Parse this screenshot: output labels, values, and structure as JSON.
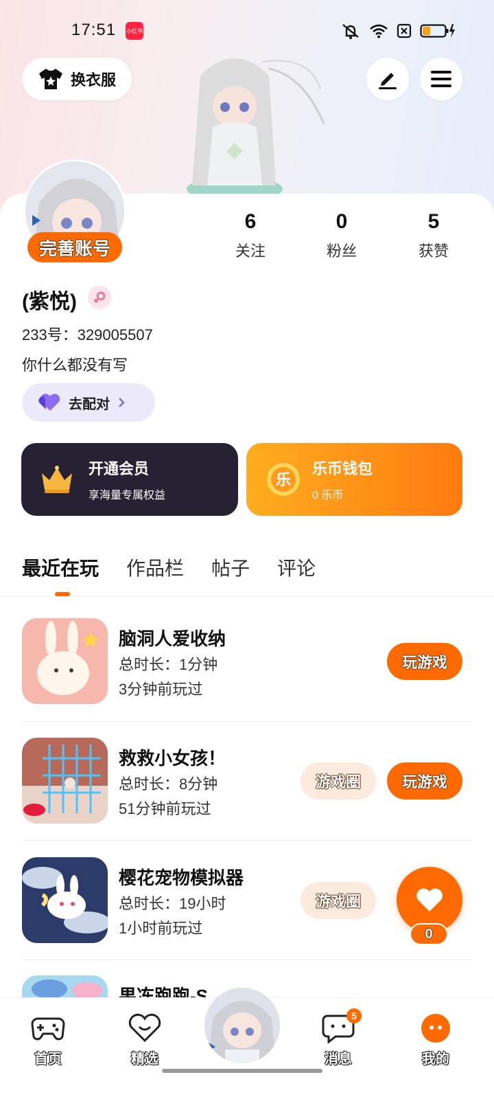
{
  "status_bar": {
    "time": "17:51",
    "app_badge": "小红书"
  },
  "header": {
    "wardrobe_label": "换衣服"
  },
  "profile": {
    "complete_account_label": "完善账号",
    "stats": [
      {
        "num": "6",
        "label": "关注"
      },
      {
        "num": "0",
        "label": "粉丝"
      },
      {
        "num": "5",
        "label": "获赞"
      }
    ],
    "name": "(紫悦)",
    "id_text": "233号：329005507",
    "bio": "你什么都没有写",
    "match_label": "去配对"
  },
  "cards": {
    "vip": {
      "title": "开通会员",
      "subtitle": "享海量专属权益"
    },
    "coin": {
      "icon_char": "乐",
      "title": "乐币钱包",
      "subtitle": "0 乐币"
    }
  },
  "tabs": [
    "最近在玩",
    "作品栏",
    "帖子",
    "评论"
  ],
  "games": [
    {
      "title": "脑洞人爱收纳",
      "duration": "总时长：1分钟",
      "last_played": "3分钟前玩过",
      "play_label": "玩游戏",
      "circle_label": ""
    },
    {
      "title": "救救小女孩！",
      "duration": "总时长：8分钟",
      "last_played": "51分钟前玩过",
      "play_label": "玩游戏",
      "circle_label": "游戏圈"
    },
    {
      "title": "樱花宠物模拟器",
      "duration": "总时长：19小时",
      "last_played": "1小时前玩过",
      "play_label": "",
      "circle_label": "游戏圈"
    },
    {
      "title": "果冻跑跑-S",
      "duration": "",
      "last_played": "",
      "play_label": "",
      "circle_label": ""
    }
  ],
  "like_fab": {
    "count": "0"
  },
  "bottom_nav": {
    "home": "首页",
    "featured": "精选",
    "messages": "消息",
    "messages_badge": "5",
    "me": "我的"
  },
  "colors": {
    "accent": "#ff6a00",
    "vip_bg": "#262234",
    "match_bg": "#ece9fb"
  }
}
